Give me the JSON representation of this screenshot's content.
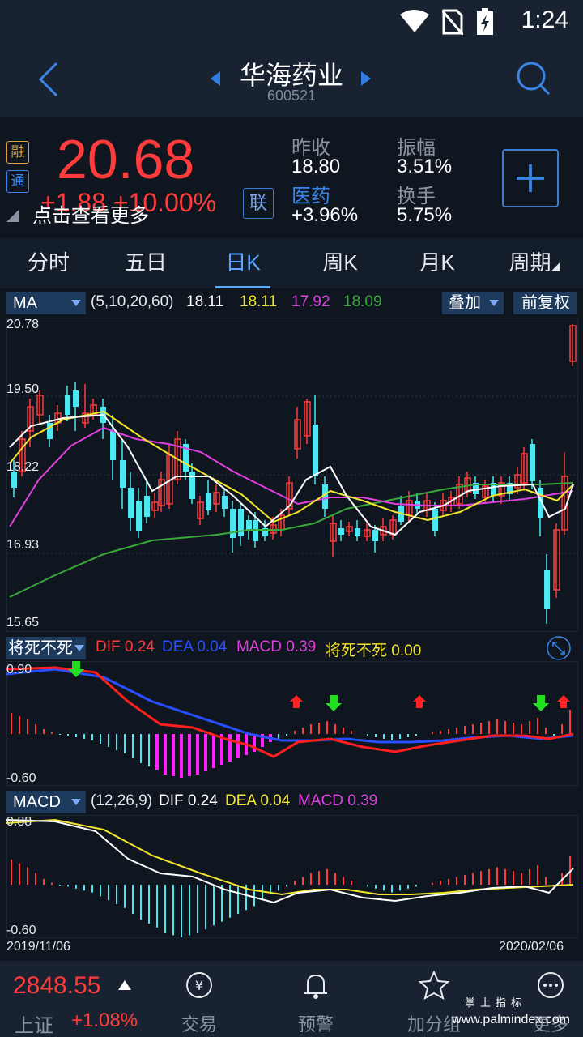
{
  "status": {
    "time": "1:24"
  },
  "header": {
    "title": "华海药业",
    "code": "600521"
  },
  "quote": {
    "badge_rong": "融",
    "badge_tong": "通",
    "price": "20.68",
    "change": "+1.88  +10.00%",
    "hint": "点击查看更多",
    "lian": "联",
    "prev_close_label": "昨收",
    "prev_close_value": "18.80",
    "amplitude_label": "振幅",
    "amplitude_value": "3.51%",
    "sector_label": "医药",
    "sector_value": "+3.96%",
    "turnover_label": "换手",
    "turnover_value": "5.75%"
  },
  "tabs": [
    {
      "label": "分时"
    },
    {
      "label": "五日"
    },
    {
      "label": "日K"
    },
    {
      "label": "周K"
    },
    {
      "label": "月K"
    },
    {
      "label": "周期"
    }
  ],
  "ma_panel": {
    "select": "MA",
    "params": "(5,10,20,60)",
    "v1": "18.11",
    "v2": "18.11",
    "v3": "17.92",
    "v4": "18.09",
    "overlay": "叠加",
    "adjust": "前复权",
    "axis": [
      "20.78",
      "19.50",
      "18.22",
      "16.93",
      "15.65"
    ]
  },
  "signal_panel": {
    "select": "将死不死",
    "dif_label": "DIF",
    "dif": "0.24",
    "dea_label": "DEA",
    "dea": "0.04",
    "macd_label": "MACD",
    "macd": "0.39",
    "jsbs_label": "将死不死",
    "jsbs": "0.00",
    "axis_top": "0.90",
    "axis_bottom": "-0.60"
  },
  "macd_panel": {
    "select": "MACD",
    "params": "(12,26,9)",
    "dif_label": "DIF",
    "dif": "0.24",
    "dea_label": "DEA",
    "dea": "0.04",
    "macd_label": "MACD",
    "macd": "0.39",
    "axis_top": "0.88",
    "axis_bottom": "-0.60",
    "date_start": "2019/11/06",
    "date_end": "2020/02/06"
  },
  "bottom": {
    "index_value": "2848.55",
    "index_name": "上证",
    "index_change": "+1.08%",
    "nav": [
      {
        "label": "交易"
      },
      {
        "label": "预警"
      },
      {
        "label": "加分组"
      },
      {
        "label": "更多"
      }
    ],
    "watermark": "www.palmindex.com",
    "watermark_cn": "掌上指标"
  },
  "colors": {
    "up": "#ff3b3b",
    "down": "#4ee6f0",
    "ma5": "#ffffff",
    "ma10": "#f2e52b",
    "ma20": "#e040e0",
    "ma60": "#3aa83a"
  }
}
